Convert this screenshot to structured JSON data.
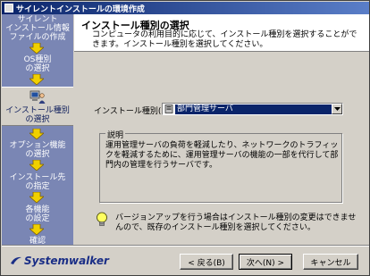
{
  "window": {
    "title": "サイレントインストールの環境作成"
  },
  "sidebar": {
    "steps": [
      {
        "lines": [
          "サイレント",
          "インストール情報",
          "ファイルの作成"
        ]
      },
      {
        "lines": [
          "OS種別",
          "の選択"
        ]
      },
      {
        "lines": [
          "インストール種別",
          "の選択"
        ],
        "active": true
      },
      {
        "lines": [
          "オプション機能",
          "の選択"
        ]
      },
      {
        "lines": [
          "インストール先",
          "の指定"
        ]
      },
      {
        "lines": [
          "各機能",
          "の設定"
        ]
      },
      {
        "lines": [
          "確認"
        ]
      }
    ]
  },
  "header": {
    "title": "インストール種別の選択",
    "description": "コンピュータの利用目的に応じて、インストール種別を選択することができます。インストール種別を選択してください。"
  },
  "form": {
    "install_type_label": "インストール種別(I)",
    "install_type_value": "部門管理サーバ"
  },
  "explanation": {
    "title": "説明",
    "text": "運用管理サーバの負荷を軽減したり、ネットワークのトラフィックを軽減するために、運用管理サーバの機能の一部を代行して部門内の管理を行うサーバです。"
  },
  "note": {
    "text": "バージョンアップを行う場合はインストール種別の変更はできませんので、既存のインストール種別を選択してください。"
  },
  "footer": {
    "logo": "Systemwalker",
    "back_label": "< 戻る(B)",
    "next_label": "次へ(N) >",
    "cancel_label": "キャンセル"
  },
  "colors": {
    "sidebar": "#7a86b4",
    "titlebar": "#0a246a",
    "selection": "#0a246a",
    "arrow": "#f0d000"
  }
}
